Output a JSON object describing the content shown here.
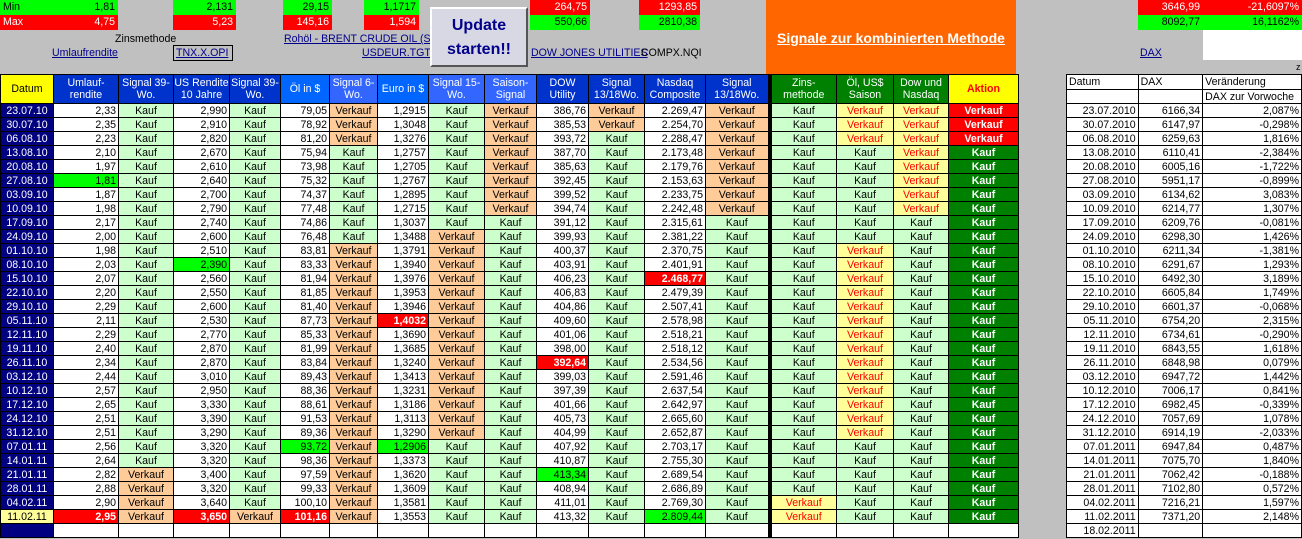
{
  "top": {
    "min_label": "Min",
    "max_label": "Max",
    "min_vals": [
      "1,81",
      "2,131",
      "29,15",
      "1,1717",
      "264,75",
      "1293,85",
      "3646,99",
      "-21,6097%"
    ],
    "max_vals": [
      "4,75",
      "5,23",
      "145,16",
      "1,594",
      "550,66",
      "2810,38",
      "8092,77",
      "16,1162%"
    ],
    "zinsmethode": "Zinsmethode",
    "umlaufrendite": "Umlaufrendite",
    "tnx": "TNX.X.OPI",
    "oil": "Rohöl - BRENT CRUDE OIL (SP",
    "usdeur": "USDEUR.TGT",
    "dowu": "DOW JONES UTILITIES",
    "compx": "COMPX.NQI",
    "dax": "DAX",
    "z": "z",
    "update_label": "Update starten!!",
    "signal_title": "Signale zur kombinierten Methode"
  },
  "colors": {
    "header_blue": "#0033cc",
    "header_yellow": "#ffff00",
    "green": "#008000",
    "light_green": "#ccffcc",
    "light_orange": "#ffcc99",
    "orange": "#ff6600"
  },
  "headers": [
    "Datum",
    "Umlauf- rendite",
    "Signal 39-Wo.",
    "US Rendite 10 Jahre",
    "Signal 39-Wo.",
    "Öl in $",
    "Signal 6-Wo.",
    "Euro in $",
    "Signal 15-Wo.",
    "Saison- Signal",
    "DOW Utility",
    "Signal 13/18Wo.",
    "Nasdaq Composite",
    "Signal 13/18Wo.",
    "Zins- methode",
    "Öl, US$ Saison",
    "Dow und Nasdaq",
    "Aktion"
  ],
  "dax_headers": [
    "Datum",
    "DAX",
    "Veränderung",
    "DAX zur Vorwoche"
  ],
  "rows": [
    [
      "23.07.10",
      "2,33",
      "Kauf",
      "2,990",
      "Kauf",
      "79,05",
      "Verkauf",
      "1,2915",
      "Kauf",
      "Verkauf",
      "386,76",
      "Verkauf",
      "2.269,47",
      "Verkauf",
      "Kauf",
      "Verkauf",
      "Verkauf",
      "Verkauf"
    ],
    [
      "30.07.10",
      "2,35",
      "Kauf",
      "2,910",
      "Kauf",
      "78,92",
      "Verkauf",
      "1,3048",
      "Kauf",
      "Verkauf",
      "385,53",
      "Verkauf",
      "2.254,70",
      "Verkauf",
      "Kauf",
      "Verkauf",
      "Verkauf",
      "Verkauf"
    ],
    [
      "06.08.10",
      "2,23",
      "Kauf",
      "2,820",
      "Kauf",
      "81,20",
      "Verkauf",
      "1,3276",
      "Kauf",
      "Verkauf",
      "393,72",
      "Kauf",
      "2.288,47",
      "Verkauf",
      "Kauf",
      "Verkauf",
      "Verkauf",
      "Verkauf"
    ],
    [
      "13.08.10",
      "2,10",
      "Kauf",
      "2,670",
      "Kauf",
      "75,94",
      "Kauf",
      "1,2757",
      "Kauf",
      "Verkauf",
      "387,70",
      "Kauf",
      "2.173,48",
      "Verkauf",
      "Kauf",
      "Kauf",
      "Verkauf",
      "Kauf"
    ],
    [
      "20.08.10",
      "1,97",
      "Kauf",
      "2,610",
      "Kauf",
      "73,98",
      "Kauf",
      "1,2705",
      "Kauf",
      "Verkauf",
      "385,63",
      "Kauf",
      "2.179,76",
      "Verkauf",
      "Kauf",
      "Kauf",
      "Verkauf",
      "Kauf"
    ],
    [
      "27.08.10",
      "1,81",
      "Kauf",
      "2,640",
      "Kauf",
      "75,32",
      "Kauf",
      "1,2767",
      "Kauf",
      "Verkauf",
      "392,45",
      "Kauf",
      "2.153,63",
      "Verkauf",
      "Kauf",
      "Kauf",
      "Verkauf",
      "Kauf"
    ],
    [
      "03.09.10",
      "1,87",
      "Kauf",
      "2,700",
      "Kauf",
      "74,37",
      "Kauf",
      "1,2895",
      "Kauf",
      "Verkauf",
      "399,52",
      "Kauf",
      "2.233,75",
      "Verkauf",
      "Kauf",
      "Kauf",
      "Verkauf",
      "Kauf"
    ],
    [
      "10.09.10",
      "1,98",
      "Kauf",
      "2,790",
      "Kauf",
      "77,48",
      "Kauf",
      "1,2715",
      "Kauf",
      "Verkauf",
      "394,74",
      "Kauf",
      "2.242,48",
      "Verkauf",
      "Kauf",
      "Kauf",
      "Verkauf",
      "Kauf"
    ],
    [
      "17.09.10",
      "2,17",
      "Kauf",
      "2,740",
      "Kauf",
      "74,86",
      "Kauf",
      "1,3037",
      "Kauf",
      "Kauf",
      "391,12",
      "Kauf",
      "2.315,61",
      "Kauf",
      "Kauf",
      "Kauf",
      "Kauf",
      "Kauf"
    ],
    [
      "24.09.10",
      "2,00",
      "Kauf",
      "2,600",
      "Kauf",
      "76,48",
      "Kauf",
      "1,3488",
      "Verkauf",
      "Kauf",
      "399,93",
      "Kauf",
      "2.381,22",
      "Kauf",
      "Kauf",
      "Kauf",
      "Kauf",
      "Kauf"
    ],
    [
      "01.10.10",
      "1,98",
      "Kauf",
      "2,510",
      "Kauf",
      "83,81",
      "Verkauf",
      "1,3791",
      "Verkauf",
      "Kauf",
      "400,37",
      "Kauf",
      "2.370,75",
      "Kauf",
      "Kauf",
      "Verkauf",
      "Kauf",
      "Kauf"
    ],
    [
      "08.10.10",
      "2,03",
      "Kauf",
      "2,390",
      "Kauf",
      "83,33",
      "Verkauf",
      "1,3940",
      "Verkauf",
      "Kauf",
      "403,91",
      "Kauf",
      "2.401,91",
      "Kauf",
      "Kauf",
      "Verkauf",
      "Kauf",
      "Kauf"
    ],
    [
      "15.10.10",
      "2,07",
      "Kauf",
      "2,560",
      "Kauf",
      "81,94",
      "Verkauf",
      "1,3976",
      "Verkauf",
      "Kauf",
      "406,23",
      "Kauf",
      "2.468,77",
      "Kauf",
      "Kauf",
      "Verkauf",
      "Kauf",
      "Kauf"
    ],
    [
      "22.10.10",
      "2,20",
      "Kauf",
      "2,550",
      "Kauf",
      "81,85",
      "Verkauf",
      "1,3953",
      "Verkauf",
      "Kauf",
      "406,83",
      "Kauf",
      "2.479,39",
      "Kauf",
      "Kauf",
      "Verkauf",
      "Kauf",
      "Kauf"
    ],
    [
      "29.10.10",
      "2,29",
      "Kauf",
      "2,600",
      "Kauf",
      "81,40",
      "Verkauf",
      "1,3946",
      "Verkauf",
      "Kauf",
      "404,86",
      "Kauf",
      "2.507,41",
      "Kauf",
      "Kauf",
      "Verkauf",
      "Kauf",
      "Kauf"
    ],
    [
      "05.11.10",
      "2,11",
      "Kauf",
      "2,530",
      "Kauf",
      "87,73",
      "Verkauf",
      "1,4032",
      "Verkauf",
      "Kauf",
      "409,60",
      "Kauf",
      "2.578,98",
      "Kauf",
      "Kauf",
      "Verkauf",
      "Kauf",
      "Kauf"
    ],
    [
      "12.11.10",
      "2,29",
      "Kauf",
      "2,770",
      "Kauf",
      "85,33",
      "Verkauf",
      "1,3690",
      "Verkauf",
      "Kauf",
      "401,06",
      "Kauf",
      "2.518,21",
      "Kauf",
      "Kauf",
      "Verkauf",
      "Kauf",
      "Kauf"
    ],
    [
      "19.11.10",
      "2,40",
      "Kauf",
      "2,870",
      "Kauf",
      "81,99",
      "Verkauf",
      "1,3685",
      "Verkauf",
      "Kauf",
      "398,00",
      "Kauf",
      "2.518,12",
      "Kauf",
      "Kauf",
      "Verkauf",
      "Kauf",
      "Kauf"
    ],
    [
      "26.11.10",
      "2,34",
      "Kauf",
      "2,870",
      "Kauf",
      "83,84",
      "Verkauf",
      "1,3240",
      "Verkauf",
      "Kauf",
      "392,64",
      "Kauf",
      "2.534,56",
      "Kauf",
      "Kauf",
      "Verkauf",
      "Kauf",
      "Kauf"
    ],
    [
      "03.12.10",
      "2,44",
      "Kauf",
      "3,010",
      "Kauf",
      "89,43",
      "Verkauf",
      "1,3413",
      "Verkauf",
      "Kauf",
      "399,03",
      "Kauf",
      "2.591,46",
      "Kauf",
      "Kauf",
      "Verkauf",
      "Kauf",
      "Kauf"
    ],
    [
      "10.12.10",
      "2,57",
      "Kauf",
      "2,950",
      "Kauf",
      "88,36",
      "Verkauf",
      "1,3231",
      "Verkauf",
      "Kauf",
      "397,39",
      "Kauf",
      "2.637,54",
      "Kauf",
      "Kauf",
      "Verkauf",
      "Kauf",
      "Kauf"
    ],
    [
      "17.12.10",
      "2,65",
      "Kauf",
      "3,330",
      "Kauf",
      "88,61",
      "Verkauf",
      "1,3186",
      "Verkauf",
      "Kauf",
      "401,66",
      "Kauf",
      "2.642,97",
      "Kauf",
      "Kauf",
      "Verkauf",
      "Kauf",
      "Kauf"
    ],
    [
      "24.12.10",
      "2,51",
      "Kauf",
      "3,390",
      "Kauf",
      "91,53",
      "Verkauf",
      "1,3113",
      "Verkauf",
      "Kauf",
      "405,73",
      "Kauf",
      "2.665,60",
      "Kauf",
      "Kauf",
      "Verkauf",
      "Kauf",
      "Kauf"
    ],
    [
      "31.12.10",
      "2,51",
      "Kauf",
      "3,290",
      "Kauf",
      "89,36",
      "Verkauf",
      "1,3290",
      "Verkauf",
      "Kauf",
      "404,99",
      "Kauf",
      "2.652,87",
      "Kauf",
      "Kauf",
      "Verkauf",
      "Kauf",
      "Kauf"
    ],
    [
      "07.01.11",
      "2,56",
      "Kauf",
      "3,320",
      "Kauf",
      "93,72",
      "Verkauf",
      "1,2906",
      "Kauf",
      "Kauf",
      "407,92",
      "Kauf",
      "2.703,17",
      "Kauf",
      "Kauf",
      "Kauf",
      "Kauf",
      "Kauf"
    ],
    [
      "14.01.11",
      "2,64",
      "Kauf",
      "3,320",
      "Kauf",
      "98,36",
      "Verkauf",
      "1,3373",
      "Kauf",
      "Kauf",
      "410,87",
      "Kauf",
      "2.755,30",
      "Kauf",
      "Kauf",
      "Kauf",
      "Kauf",
      "Kauf"
    ],
    [
      "21.01.11",
      "2,82",
      "Verkauf",
      "3,400",
      "Kauf",
      "97,59",
      "Verkauf",
      "1,3620",
      "Kauf",
      "Kauf",
      "413,34",
      "Kauf",
      "2.689,54",
      "Kauf",
      "Kauf",
      "Kauf",
      "Kauf",
      "Kauf"
    ],
    [
      "28.01.11",
      "2,88",
      "Verkauf",
      "3,320",
      "Kauf",
      "99,33",
      "Verkauf",
      "1,3609",
      "Kauf",
      "Kauf",
      "408,94",
      "Kauf",
      "2.686,89",
      "Kauf",
      "Kauf",
      "Kauf",
      "Kauf",
      "Kauf"
    ],
    [
      "04.02.11",
      "2,90",
      "Verkauf",
      "3,640",
      "Kauf",
      "100,10",
      "Verkauf",
      "1,3581",
      "Kauf",
      "Kauf",
      "411,01",
      "Kauf",
      "2.769,30",
      "Kauf",
      "Verkauf",
      "Kauf",
      "Kauf",
      "Kauf"
    ],
    [
      "11.02.11",
      "2,95",
      "Verkauf",
      "3,650",
      "Verkauf",
      "101,16",
      "Verkauf",
      "1,3553",
      "Kauf",
      "Kauf",
      "413,32",
      "Kauf",
      "2.809,44",
      "Kauf",
      "Verkauf",
      "Kauf",
      "Kauf",
      "Kauf"
    ]
  ],
  "dax_rows": [
    [
      "23.07.2010",
      "6166,34",
      "2,087%"
    ],
    [
      "30.07.2010",
      "6147,97",
      "-0,298%"
    ],
    [
      "06.08.2010",
      "6259,63",
      "1,816%"
    ],
    [
      "13.08.2010",
      "6110,41",
      "-2,384%"
    ],
    [
      "20.08.2010",
      "6005,16",
      "-1,722%"
    ],
    [
      "27.08.2010",
      "5951,17",
      "-0,899%"
    ],
    [
      "03.09.2010",
      "6134,62",
      "3,083%"
    ],
    [
      "10.09.2010",
      "6214,77",
      "1,307%"
    ],
    [
      "17.09.2010",
      "6209,76",
      "-0,081%"
    ],
    [
      "24.09.2010",
      "6298,30",
      "1,426%"
    ],
    [
      "01.10.2010",
      "6211,34",
      "-1,381%"
    ],
    [
      "08.10.2010",
      "6291,67",
      "1,293%"
    ],
    [
      "15.10.2010",
      "6492,30",
      "3,189%"
    ],
    [
      "22.10.2010",
      "6605,84",
      "1,749%"
    ],
    [
      "29.10.2010",
      "6601,37",
      "-0,068%"
    ],
    [
      "05.11.2010",
      "6754,20",
      "2,315%"
    ],
    [
      "12.11.2010",
      "6734,61",
      "-0,290%"
    ],
    [
      "19.11.2010",
      "6843,55",
      "1,618%"
    ],
    [
      "26.11.2010",
      "6848,98",
      "0,079%"
    ],
    [
      "03.12.2010",
      "6947,72",
      "1,442%"
    ],
    [
      "10.12.2010",
      "7006,17",
      "0,841%"
    ],
    [
      "17.12.2010",
      "6982,45",
      "-0,339%"
    ],
    [
      "24.12.2010",
      "7057,69",
      "1,078%"
    ],
    [
      "31.12.2010",
      "6914,19",
      "-2,033%"
    ],
    [
      "07.01.2011",
      "6947,84",
      "0,487%"
    ],
    [
      "14.01.2011",
      "7075,70",
      "1,840%"
    ],
    [
      "21.01.2011",
      "7062,42",
      "-0,188%"
    ],
    [
      "28.01.2011",
      "7102,80",
      "0,572%"
    ],
    [
      "04.02.2011",
      "7216,21",
      "1,597%"
    ],
    [
      "11.02.2011",
      "7371,20",
      "2,148%"
    ],
    [
      "18.02.2011",
      "",
      ""
    ]
  ]
}
